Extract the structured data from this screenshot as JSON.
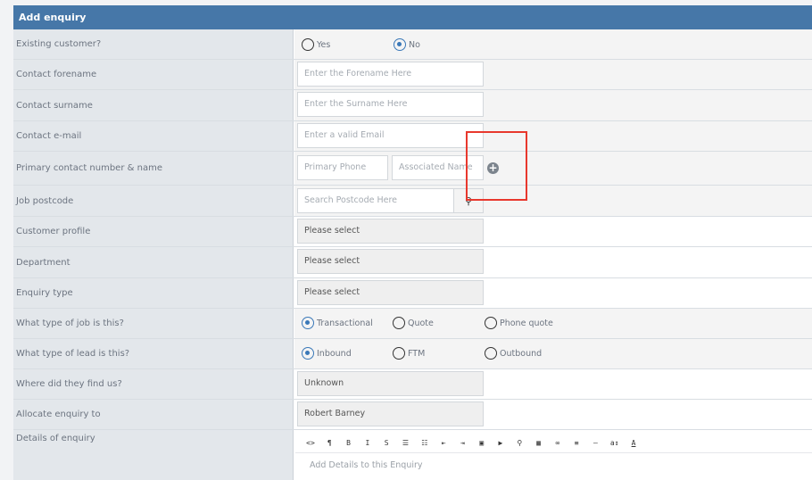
{
  "form": {
    "title": "Add enquiry",
    "rows": {
      "existing_customer": {
        "label": "Existing customer?",
        "options": [
          "Yes",
          "No"
        ],
        "selected": "No"
      },
      "forename": {
        "label": "Contact forename",
        "placeholder": "Enter the Forename Here"
      },
      "surname": {
        "label": "Contact surname",
        "placeholder": "Enter the Surname Here"
      },
      "email": {
        "label": "Contact e-mail",
        "placeholder": "Enter a valid Email"
      },
      "phone": {
        "label": "Primary contact number & name",
        "phone_placeholder": "Primary Phone",
        "name_placeholder": "Associated Name"
      },
      "postcode": {
        "label": "Job postcode",
        "placeholder": "Search Postcode Here"
      },
      "customer_profile": {
        "label": "Customer profile",
        "value": "Please select"
      },
      "department": {
        "label": "Department",
        "value": "Please select"
      },
      "enquiry_type": {
        "label": "Enquiry type",
        "value": "Please select"
      },
      "job_type": {
        "label": "What type of job is this?",
        "options": [
          "Transactional",
          "Quote",
          "Phone quote"
        ],
        "selected": "Transactional"
      },
      "lead_type": {
        "label": "What type of lead is this?",
        "options": [
          "Inbound",
          "FTM",
          "Outbound"
        ],
        "selected": "Inbound"
      },
      "found_us": {
        "label": "Where did they find us?",
        "value": "Unknown"
      },
      "allocate_to": {
        "label": "Allocate enquiry to",
        "value": "Robert Barney"
      },
      "details": {
        "label": "Details of enquiry",
        "placeholder": "Add Details to this Enquiry"
      }
    },
    "editor_toolbar": [
      "<>",
      "¶",
      "B",
      "I",
      "S",
      "☰",
      "☷",
      "⇤",
      "⇥",
      "▣",
      "▶",
      "⚲",
      "▦",
      "∞",
      "≡",
      "—",
      "a↕",
      "A"
    ]
  },
  "colors": {
    "header": "#4677a8",
    "label_bg": "#e3e7eb",
    "accent": "#3a78b8",
    "highlight": "#e8382d"
  }
}
